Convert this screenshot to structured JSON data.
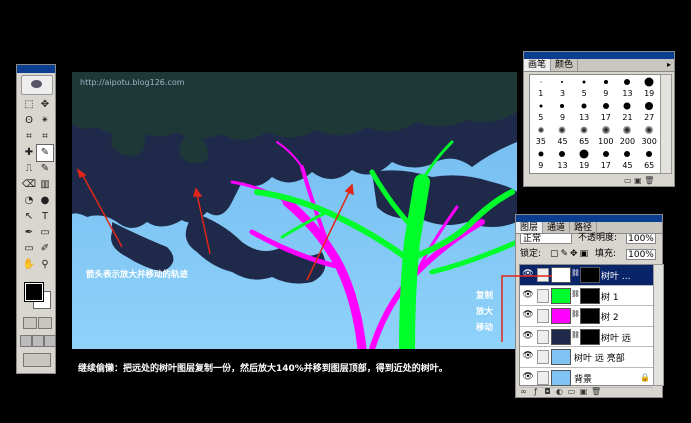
{
  "canvas": {
    "watermark": "http://aipotu.blog126.com",
    "arrow_note": "箭头表示放大并移动的轨迹",
    "side_note": [
      "复制",
      "放大",
      "移动"
    ],
    "colors": {
      "sky": "#7fc4f3",
      "canopy_far": "#1f2a4a",
      "foliage_dark": "#213a3a",
      "branch_magenta": "#ff00ff",
      "branch_green": "#00ff2a",
      "arrow_red": "#e0261a"
    }
  },
  "caption": "继续偷懒：把远处的树叶图层复制一份，然后放大140%并移到图层顶部，得到近处的树叶。",
  "tools": {
    "items": [
      "marquee-icon",
      "move-icon",
      "lasso-icon",
      "magic-wand-icon",
      "crop-icon",
      "slice-icon",
      "healing-icon",
      "brush-icon",
      "stamp-icon",
      "history-brush-icon",
      "eraser-icon",
      "gradient-icon",
      "blur-icon",
      "dodge-icon",
      "path-select-icon",
      "type-icon",
      "pen-icon",
      "shape-icon",
      "notes-icon",
      "eyedropper-icon",
      "hand-icon",
      "zoom-icon"
    ],
    "glyphs": [
      "⬚",
      "✥",
      "ʘ",
      "✴",
      "⌗",
      "⌗",
      "✚",
      "✎",
      "⎍",
      "✎",
      "⌫",
      "▥",
      "◔",
      "●",
      "↖",
      "T",
      "✒",
      "▭",
      "▭",
      "✐",
      "✋",
      "⚲"
    ]
  },
  "brushes": {
    "tabs": [
      "画笔",
      "颜色"
    ],
    "items": [
      {
        "label": "1",
        "size": 1
      },
      {
        "label": "3",
        "size": 2
      },
      {
        "label": "5",
        "size": 3
      },
      {
        "label": "9",
        "size": 4
      },
      {
        "label": "13",
        "size": 6
      },
      {
        "label": "19",
        "size": 9
      },
      {
        "label": "5",
        "size": 3
      },
      {
        "label": "9",
        "size": 4
      },
      {
        "label": "13",
        "size": 5
      },
      {
        "label": "17",
        "size": 6
      },
      {
        "label": "21",
        "size": 7
      },
      {
        "label": "27",
        "size": 8
      },
      {
        "label": "35",
        "size": 6
      },
      {
        "label": "45",
        "size": 7
      },
      {
        "label": "65",
        "size": 7
      },
      {
        "label": "100",
        "size": 8
      },
      {
        "label": "200",
        "size": 8
      },
      {
        "label": "300",
        "size": 8
      },
      {
        "label": "9",
        "size": 5
      },
      {
        "label": "13",
        "size": 6
      },
      {
        "label": "19",
        "size": 9
      },
      {
        "label": "17",
        "size": 6
      },
      {
        "label": "45",
        "size": 6
      },
      {
        "label": "65",
        "size": 6
      }
    ]
  },
  "layers": {
    "tabs": [
      "图层",
      "通道",
      "路径"
    ],
    "blend_mode": "正常",
    "opacity_label": "不透明度:",
    "opacity": "100%",
    "lock_label": "锁定:",
    "fill_label": "填充:",
    "fill": "100%",
    "items": [
      {
        "name": "树叶 ...",
        "thumb": "#ffffff",
        "selected": true,
        "mask": true
      },
      {
        "name": "树 1",
        "thumb": "#00ff2a",
        "selected": false,
        "mask": true
      },
      {
        "name": "树 2",
        "thumb": "#ff00ff",
        "selected": false,
        "mask": true
      },
      {
        "name": "树叶 远",
        "thumb": "#1f2a4a",
        "selected": false,
        "mask": true
      },
      {
        "name": "树叶 远 亮部",
        "thumb": "#7fc4f3",
        "selected": false,
        "mask": false
      },
      {
        "name": "背景",
        "thumb": "#7fc4f3",
        "selected": false,
        "mask": false,
        "locked": true
      }
    ]
  }
}
